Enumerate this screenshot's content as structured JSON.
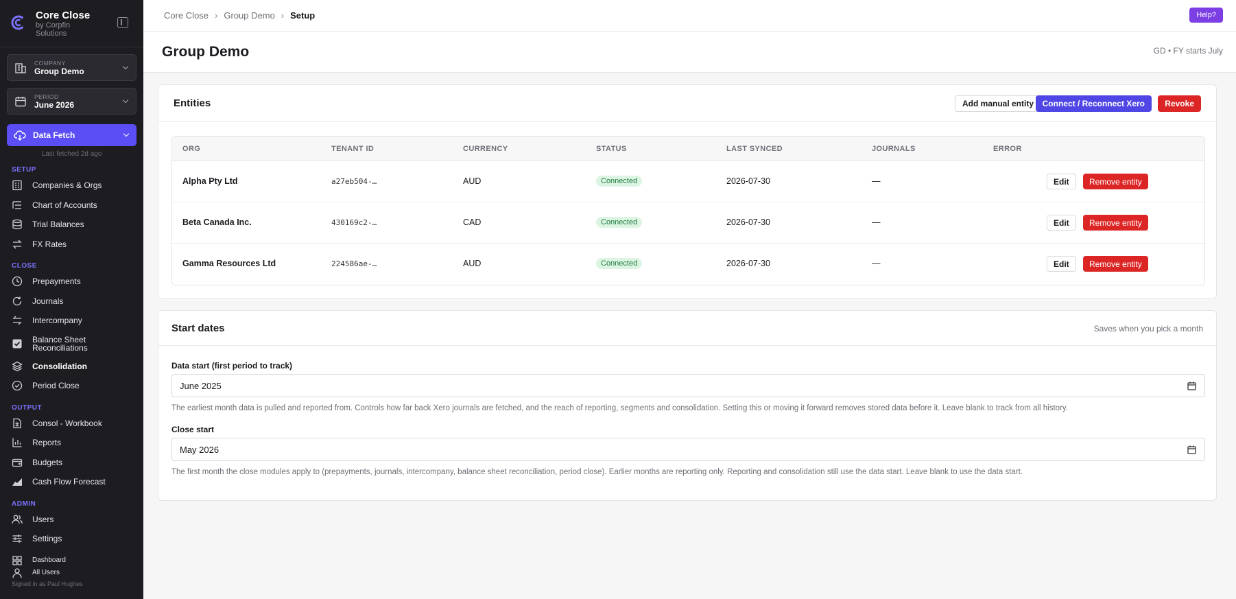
{
  "brand": {
    "title": "Core Close",
    "subtitle_line1": "by Corpfin",
    "subtitle_line2": "Solutions"
  },
  "company_selector": {
    "label": "COMPANY",
    "value": "Group Demo"
  },
  "period_selector": {
    "label": "PERIOD",
    "value": "June 2026"
  },
  "data_fetch": {
    "label": "Data Fetch",
    "last_fetched": "Last fetched 2d ago"
  },
  "nav": {
    "setup_label": "SETUP",
    "setup": [
      "Companies & Orgs",
      "Chart of Accounts",
      "Trial Balances",
      "FX Rates"
    ],
    "close_label": "CLOSE",
    "close": [
      "Prepayments",
      "Journals",
      "Intercompany",
      "Balance Sheet",
      "Reconciliations",
      "Consolidation",
      "Period Close"
    ],
    "output_label": "OUTPUT",
    "output": [
      "Consol - Workbook",
      "Reports",
      "Budgets",
      "Cash Flow Forecast"
    ],
    "admin_label": "ADMIN",
    "admin": [
      "Users",
      "Settings",
      "Dashboard",
      "All Users"
    ],
    "signed_in": "Signed in as Paul Hughes"
  },
  "breadcrumb": [
    "Core Close",
    "Group Demo",
    "Setup"
  ],
  "help_label": "Help?",
  "page": {
    "title": "Group Demo",
    "meta": "GD • FY starts July"
  },
  "entities": {
    "title": "Entities",
    "add_label": "Add manual entity",
    "connect_label": "Connect / Reconnect Xero",
    "revoke_label": "Revoke",
    "columns": [
      "ORG",
      "TENANT ID",
      "CURRENCY",
      "STATUS",
      "LAST SYNCED",
      "JOURNALS",
      "ERROR"
    ],
    "rows": [
      {
        "org": "Alpha Pty Ltd",
        "tenant": "a27eb504-…",
        "currency": "AUD",
        "status": "Connected",
        "last_synced": "2026-07-30",
        "journals": "—",
        "edit": "Edit",
        "remove": "Remove entity"
      },
      {
        "org": "Beta Canada Inc.",
        "tenant": "430169c2-…",
        "currency": "CAD",
        "status": "Connected",
        "last_synced": "2026-07-30",
        "journals": "—",
        "edit": "Edit",
        "remove": "Remove entity"
      },
      {
        "org": "Gamma Resources Ltd",
        "tenant": "224586ae-…",
        "currency": "AUD",
        "status": "Connected",
        "last_synced": "2026-07-30",
        "journals": "—",
        "edit": "Edit",
        "remove": "Remove entity"
      }
    ]
  },
  "start_dates": {
    "title": "Start dates",
    "note": "Saves when you pick a month",
    "data_start_label": "Data start (first period to track)",
    "data_start_value": "June 2025",
    "data_start_help": "The earliest month data is pulled and reported from. Controls how far back Xero journals are fetched, and the reach of reporting, segments and consolidation. Setting this or moving it forward removes stored data before it. Leave blank to track from all history.",
    "close_start_label": "Close start",
    "close_start_value": "May 2026",
    "close_start_help": "The first month the close modules apply to (prepayments, journals, intercompany, balance sheet reconciliation, period close). Earlier months are reporting only. Reporting and consolidation still use the data start. Leave blank to use the data start."
  }
}
